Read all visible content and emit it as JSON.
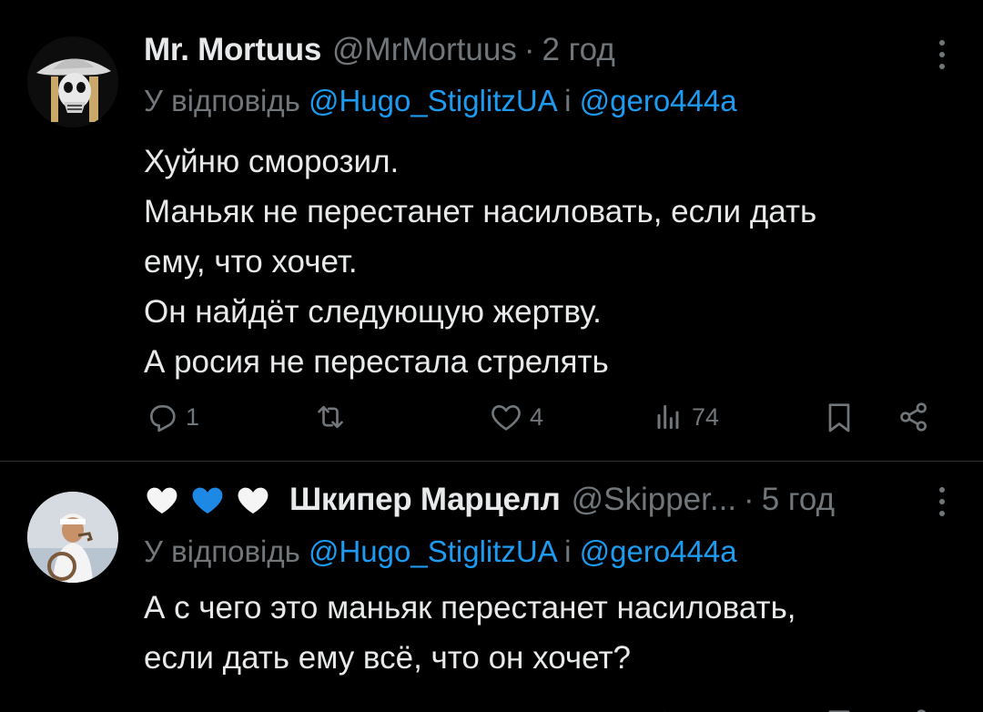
{
  "tweets": [
    {
      "name": "Mr. Mortuus",
      "handle": "@MrMortuus",
      "dot": "·",
      "time": "2 год",
      "reply_prefix": "У відповідь",
      "reply_user1": "@Hugo_StiglitzUA",
      "reply_and": "і",
      "reply_user2": "@gero444a",
      "body": [
        "Хуйню сморозил.",
        "Маньяк не перестанет насиловать, если дать",
        "ему, что хочет.",
        "Он найдёт следующую жертву.",
        "А росия не перестала стрелять"
      ],
      "actions": {
        "reply_count": "1",
        "retweet_count": "",
        "like_count": "4",
        "views_count": "74"
      }
    },
    {
      "name": "Шкипер Марцелл",
      "handle": "@Skipper...",
      "dot": "·",
      "time": "5 год",
      "reply_prefix": "У відповідь",
      "reply_user1": "@Hugo_StiglitzUA",
      "reply_and": "і",
      "reply_user2": "@gero444a",
      "body": [
        "А с чего это маньяк перестанет насиловать,",
        "если дать ему всё, что он хочет?"
      ]
    }
  ],
  "icons": {
    "reply": "reply-icon",
    "retweet": "retweet-icon",
    "like": "heart-icon",
    "views": "views-icon",
    "bookmark": "bookmark-icon",
    "share": "share-icon",
    "more": "more-icon"
  },
  "colors": {
    "background": "#000000",
    "text": "#e7e9ea",
    "muted": "#71767b",
    "link": "#1d9bf0",
    "divider": "#2f3336"
  }
}
